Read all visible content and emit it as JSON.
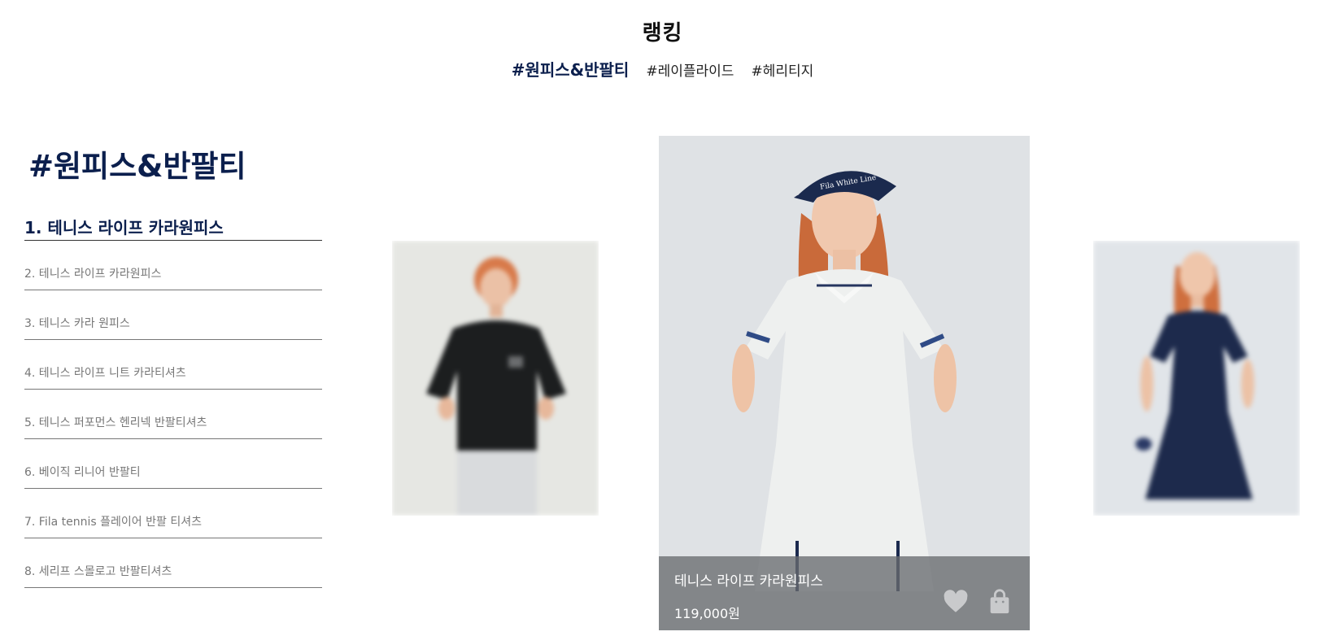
{
  "page": {
    "title": "랭킹"
  },
  "tabs": [
    {
      "label": "#원피스&반팔티",
      "active": true
    },
    {
      "label": "#레이플라이드",
      "active": false
    },
    {
      "label": "#헤리티지",
      "active": false
    }
  ],
  "section": {
    "heading": "#원피스&반팔티"
  },
  "ranking": [
    "1. 테니스 라이프 카라원피스",
    "2. 테니스 라이프 카라원피스",
    "3. 테니스 카라 원피스",
    "4. 테니스 라이프 니트 카라티셔츠",
    "5. 테니스 퍼포먼스 헨리넥 반팔티셔츠",
    "6. 베이직 리니어 반팔티",
    "7. Fila tennis 플레이어 반팔 티셔츠",
    "8. 세리프 스몰로고 반팔티셔츠"
  ],
  "featured": {
    "name": "테니스 라이프 카라원피스",
    "price": "119,000원",
    "visor_text": "Fila White Line",
    "wishlist_icon": "heart-icon",
    "cart_icon": "shopping-bag-icon"
  },
  "colors": {
    "navy": "#0b1f4d",
    "overlay": "#696c70",
    "divider": "#777777"
  }
}
